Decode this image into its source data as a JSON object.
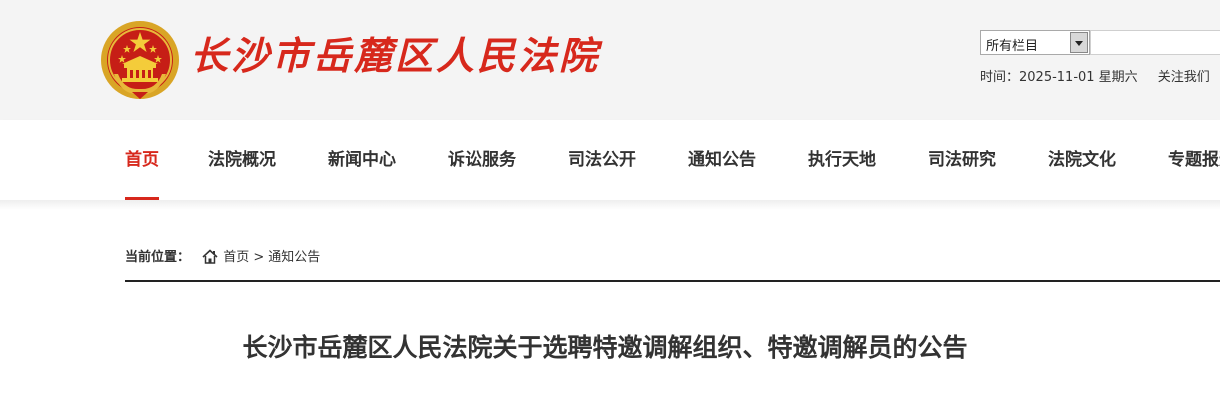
{
  "header": {
    "site_title": "长沙市岳麓区人民法院",
    "emblem_icon": "national-emblem-icon",
    "search": {
      "scope_selected": "所有栏目",
      "query": ""
    },
    "meta": {
      "date_text": "时间：2025-11-01 星期六",
      "follow_text": "关注我们"
    }
  },
  "nav": {
    "active_index": 0,
    "items": [
      {
        "label": "首页"
      },
      {
        "label": "法院概况"
      },
      {
        "label": "新闻中心"
      },
      {
        "label": "诉讼服务"
      },
      {
        "label": "司法公开"
      },
      {
        "label": "通知公告"
      },
      {
        "label": "执行天地"
      },
      {
        "label": "司法研究"
      },
      {
        "label": "法院文化"
      },
      {
        "label": "专题报道"
      }
    ]
  },
  "breadcrumb": {
    "label": "当前位置：",
    "home_icon": "home-icon",
    "home": "首页",
    "separator": ">",
    "current": "通知公告"
  },
  "article": {
    "title": "长沙市岳麓区人民法院关于选聘特邀调解组织、特邀调解员的公告"
  },
  "colors": {
    "accent": "#d7281c",
    "header_bg": "#f4f4f4",
    "text": "#333333"
  }
}
